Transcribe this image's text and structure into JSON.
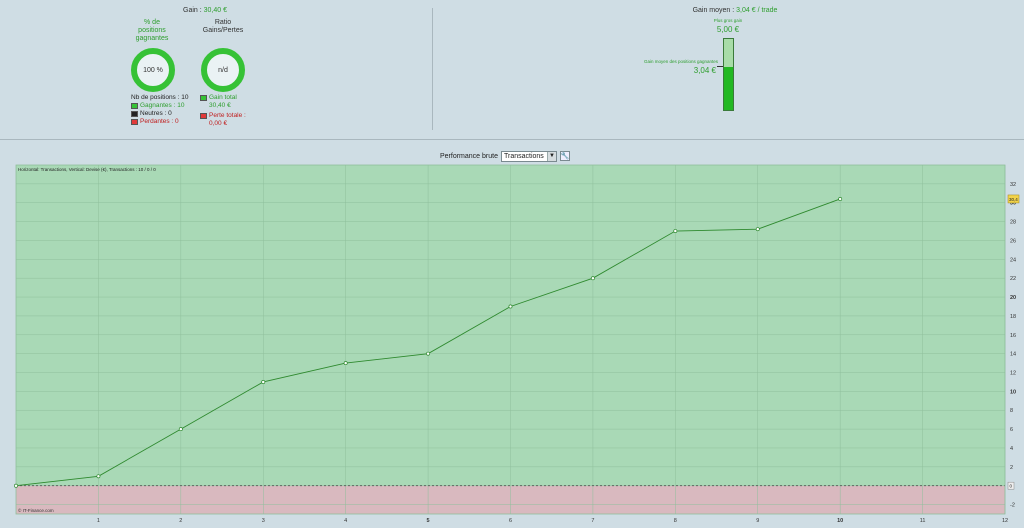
{
  "summary": {
    "gain_label": "Gain :",
    "gain_value": "30,40 €",
    "winning_title_lines": [
      "% de",
      "positions",
      "gagnantes"
    ],
    "winning_percent": "100 %",
    "ratio_title_lines": [
      "Ratio",
      "Gains/Pertes"
    ],
    "ratio_value": "n/d",
    "nb_positions_label": "Nb de positions : 10",
    "gagnantes_label": "Gagnantes : 10",
    "neutres_label": "Neutres : 0",
    "perdantes_label": "Perdantes : 0",
    "gain_total_label": "Gain total",
    "gain_total_value": "30,40 €",
    "perte_totale_label": "Perte totale :",
    "perte_totale_value": "0,00 €"
  },
  "average": {
    "title": "Gain moyen :",
    "title_value": "3,04 € / trade",
    "best_gain_label": "Plus gros gain",
    "best_gain_value": "5,00 €",
    "avg_winning_label": "Gain moyen des positions gagnantes",
    "avg_winning_value": "3,04 €",
    "gauge_fraction": 0.608
  },
  "chart_header": {
    "label": "Performance brute",
    "select_value": "Transactions"
  },
  "chart_data": {
    "type": "line",
    "info_text": "Horizontal: Transactions, Vertical: Devise (€), Transactions : 10 / 0 / 0",
    "copyright": "© IT-Finance.com",
    "x": [
      0,
      1,
      2,
      3,
      4,
      5,
      6,
      7,
      8,
      9,
      10
    ],
    "y": [
      0,
      1,
      6,
      11,
      13,
      14,
      19,
      22,
      27,
      27.2,
      30.4
    ],
    "xlim": [
      0,
      12
    ],
    "ylim": [
      -3,
      34
    ],
    "x_ticks": [
      1,
      2,
      3,
      4,
      5,
      6,
      7,
      8,
      9,
      10,
      11,
      12
    ],
    "y_ticks": [
      -2,
      0,
      2,
      4,
      6,
      8,
      10,
      12,
      14,
      16,
      18,
      20,
      22,
      24,
      26,
      28,
      30,
      32
    ],
    "last_value_label": "30,4",
    "zero_label": "0",
    "positive_color": "#a9d9b6",
    "negative_color": "#d9b9bf",
    "line_color": "#2f8a2f"
  }
}
